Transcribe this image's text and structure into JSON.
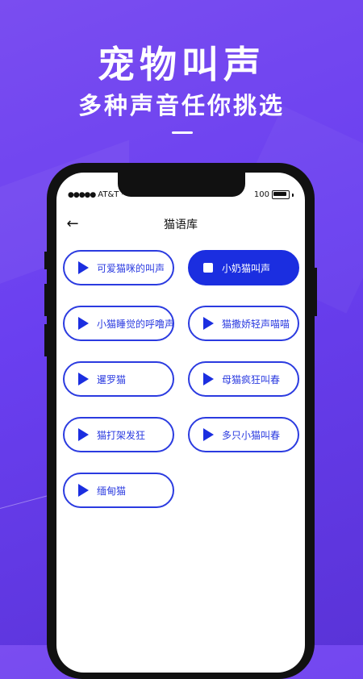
{
  "promo": {
    "headline": "宠物叫声",
    "subheadline": "多种声音任你挑选"
  },
  "status_bar": {
    "carrier": "AT&T",
    "battery": "100"
  },
  "nav": {
    "title": "猫语库"
  },
  "sounds": [
    {
      "label": "可爱猫咪的叫声",
      "state": "play"
    },
    {
      "label": "小奶猫叫声",
      "state": "playing"
    },
    {
      "label": "小猫睡觉的呼噜声",
      "state": "play"
    },
    {
      "label": "猫撒娇轻声喵喵",
      "state": "play"
    },
    {
      "label": "暹罗猫",
      "state": "play"
    },
    {
      "label": "母猫疯狂叫春",
      "state": "play"
    },
    {
      "label": "猫打架发狂",
      "state": "play"
    },
    {
      "label": "多只小猫叫春",
      "state": "play"
    },
    {
      "label": "缅甸猫",
      "state": "play"
    }
  ],
  "colors": {
    "background": "#6a3ff0",
    "accent": "#1b2ee0"
  }
}
